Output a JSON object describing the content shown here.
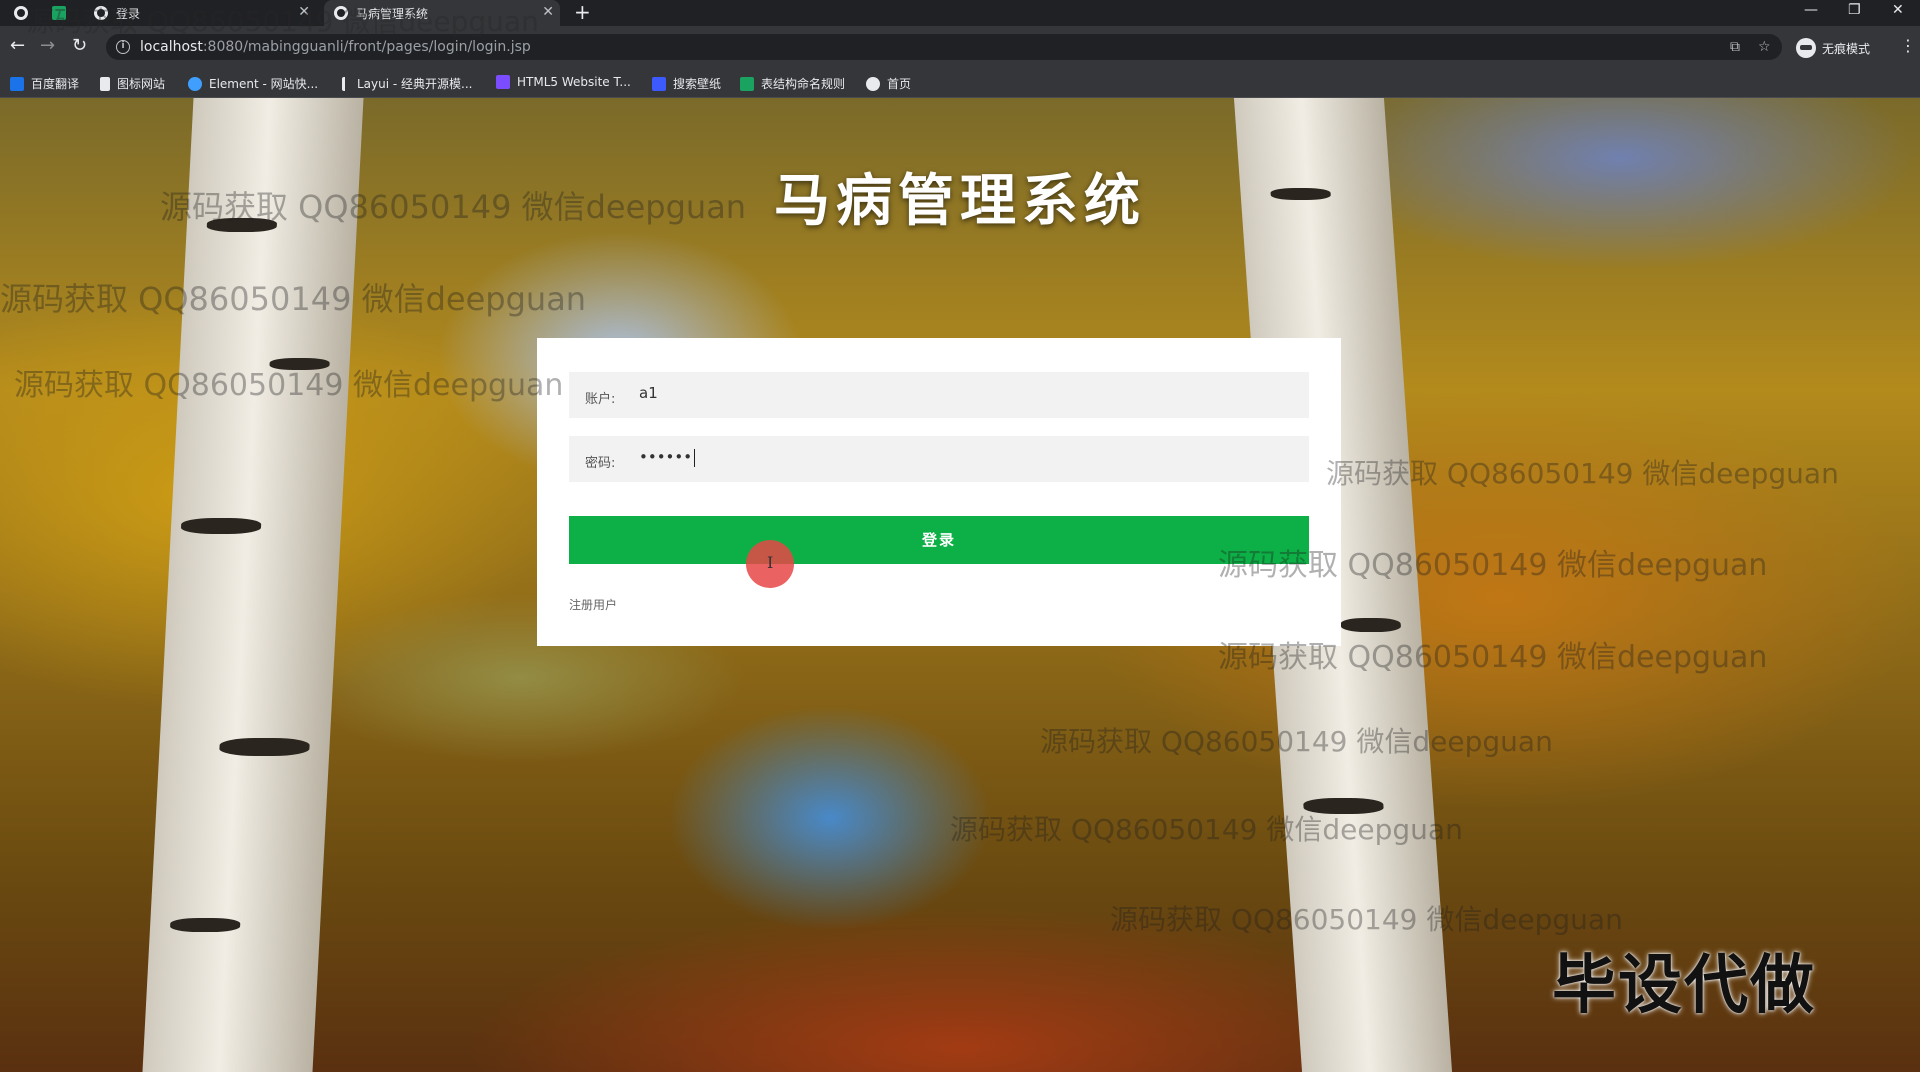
{
  "browser": {
    "tabs": [
      {
        "label": "登录"
      },
      {
        "label": "马病管理系统"
      }
    ],
    "url_host": "localhost",
    "url_path": ":8080/mabingguanli/front/pages/login/login.jsp",
    "incognito_label": "无痕模式",
    "bookmarks": [
      {
        "label": "百度翻译",
        "color": "#1a73e8"
      },
      {
        "label": "图标网站",
        "color": "#e8eaed"
      },
      {
        "label": "Element - 网站快...",
        "color": "#409eff"
      },
      {
        "label": "Layui - 经典开源模...",
        "color": "#e8eaed"
      },
      {
        "label": "HTML5 Website T...",
        "color": "#7c4dff"
      },
      {
        "label": "搜索壁纸",
        "color": "#3d5afe"
      },
      {
        "label": "表结构命名规则",
        "color": "#1aa260"
      },
      {
        "label": "首页",
        "color": "#e8eaed"
      }
    ]
  },
  "page": {
    "title": "马病管理系统",
    "form": {
      "account_label": "账户:",
      "account_value": "a1",
      "password_label": "密码:",
      "password_value": "••••••",
      "login_button": "登录",
      "register_link": "注册用户"
    },
    "colors": {
      "login_button": "#0db046"
    }
  },
  "overlay": {
    "watermark_text": "源码获取 QQ86050149 微信deepguan",
    "corner_stamp": "毕设代做"
  }
}
